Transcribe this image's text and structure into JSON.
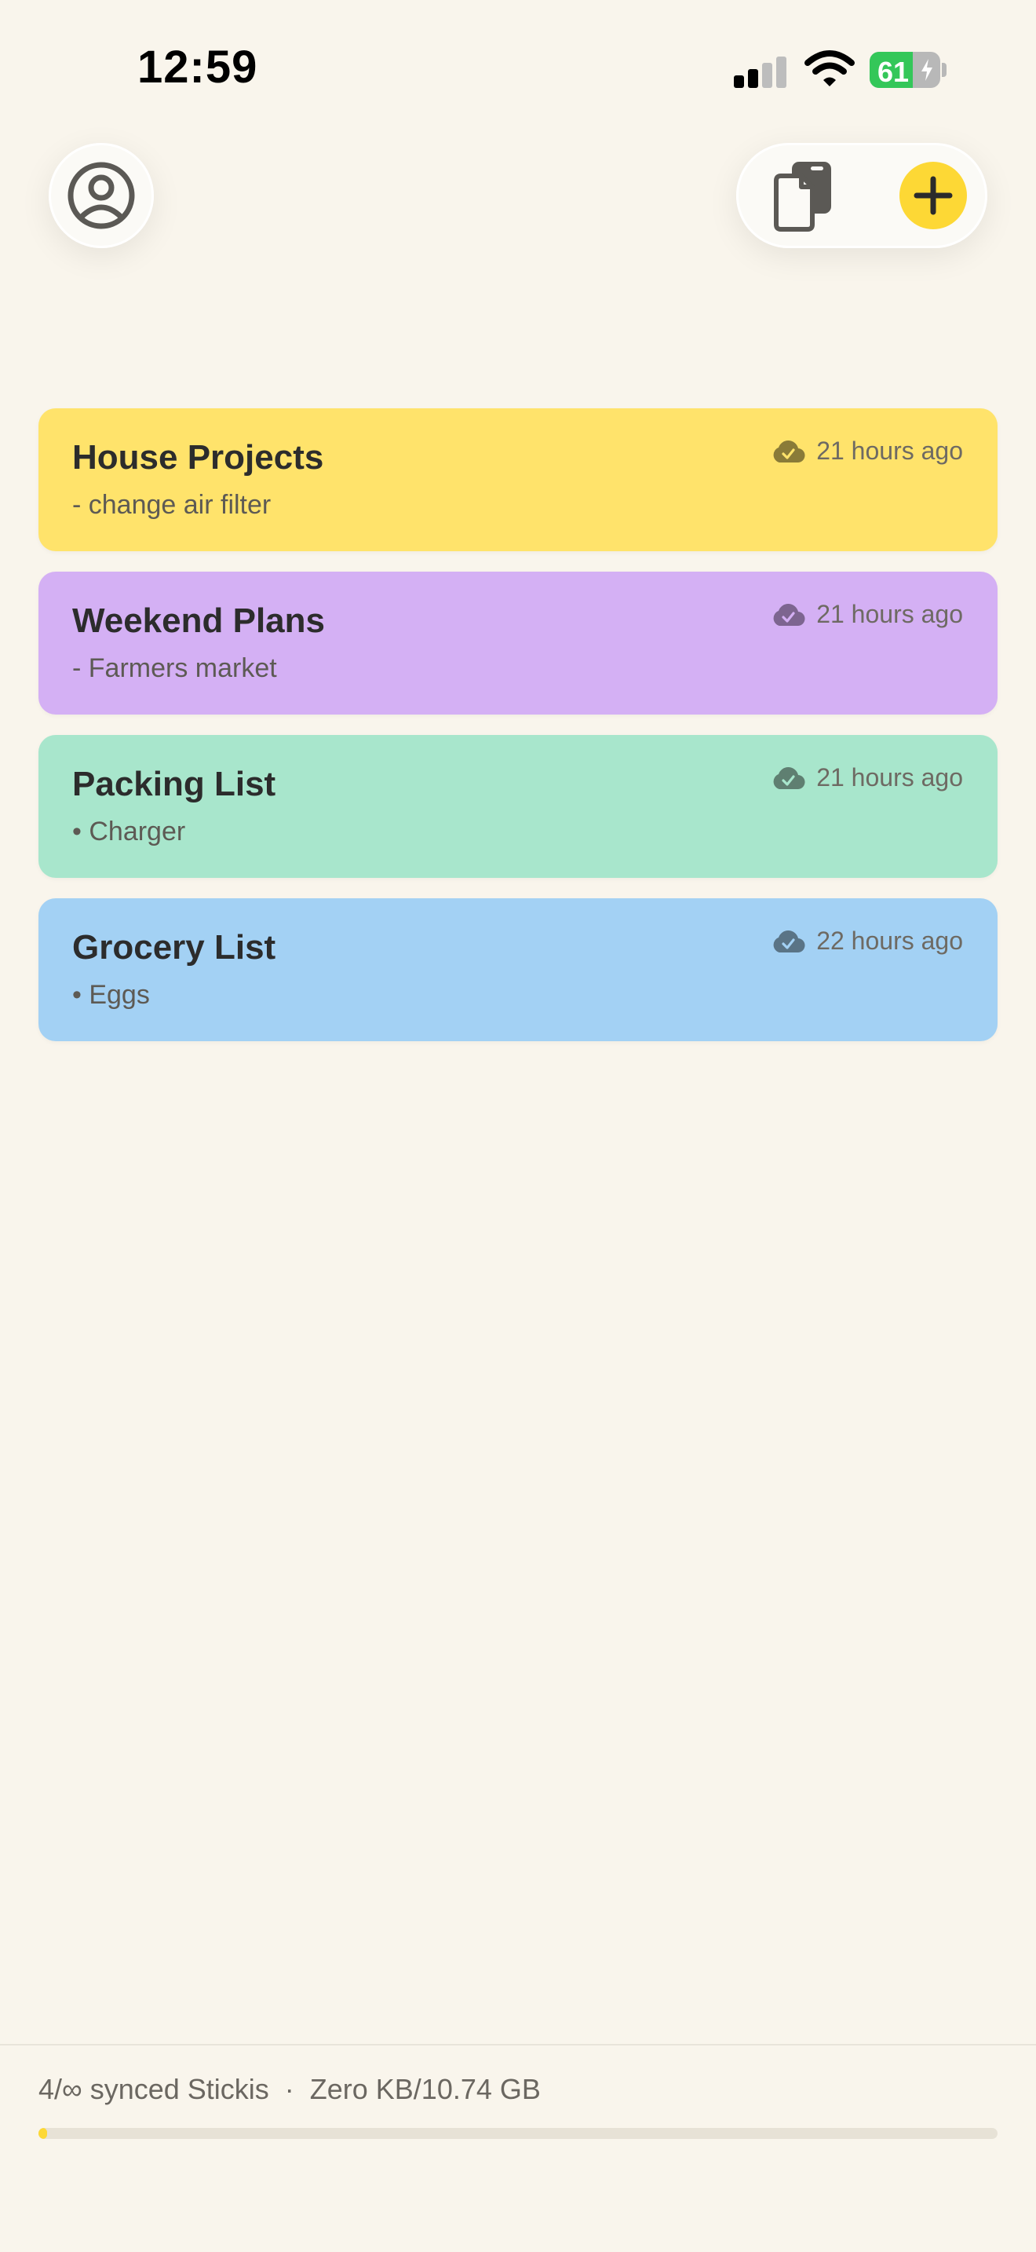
{
  "status_bar": {
    "time": "12:59",
    "battery_level": "61",
    "battery_fraction": 0.61,
    "signal_bars_active": 2,
    "signal_bars_total": 4
  },
  "header": {
    "profile_icon": "person-circle-icon",
    "copy_icon": "documents-icon",
    "add_icon": "plus-icon",
    "accent_color": "#fdd835"
  },
  "notes": [
    {
      "title": "House Projects",
      "preview": "- change air filter",
      "time": "21 hours ago",
      "color": "#ffe36b",
      "icon": "cloud-check-icon"
    },
    {
      "title": "Weekend Plans",
      "preview": "- Farmers market",
      "time": "21 hours ago",
      "color": "#d4b0f4",
      "icon": "cloud-check-icon"
    },
    {
      "title": "Packing List",
      "preview": "• Charger",
      "time": "21 hours ago",
      "color": "#a8e6cc",
      "icon": "cloud-check-icon"
    },
    {
      "title": "Grocery List",
      "preview": "• Eggs",
      "time": "22 hours ago",
      "color": "#a3d1f4",
      "icon": "cloud-check-icon"
    }
  ],
  "footer": {
    "summary": "4/∞ synced Stickis  ·  Zero KB/10.74 GB",
    "storage_used_fraction": 0.009
  }
}
